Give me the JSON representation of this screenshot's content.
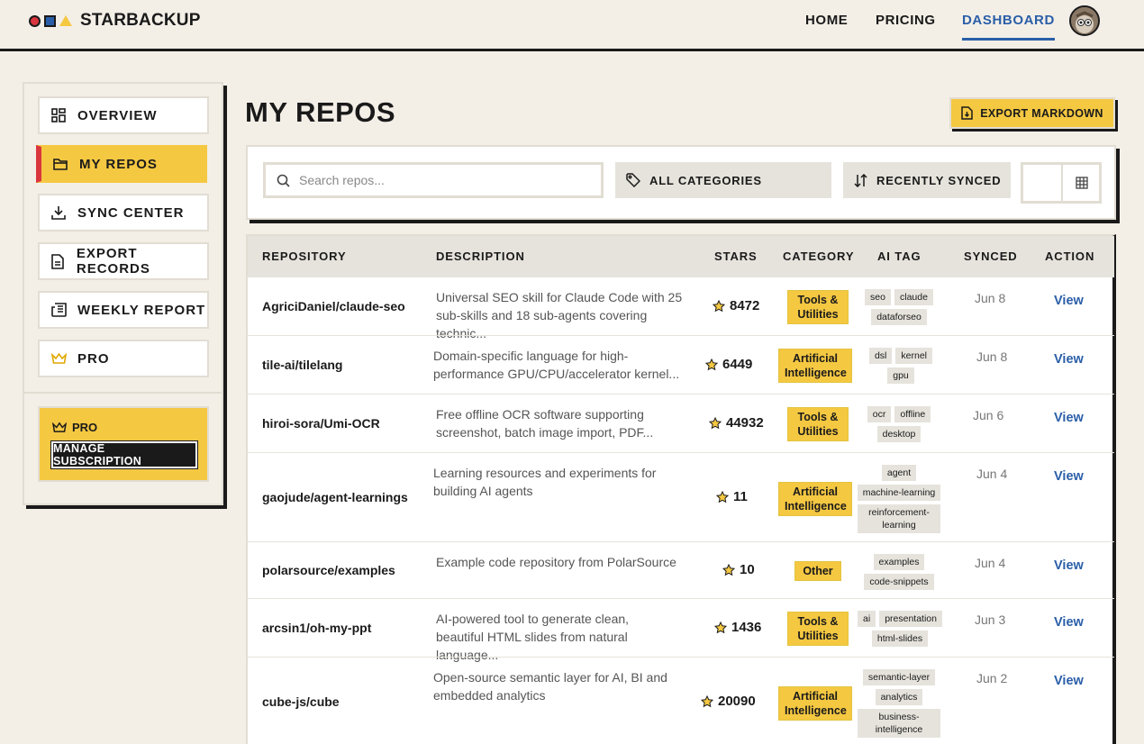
{
  "app": {
    "name": "STARBACKUP"
  },
  "nav": {
    "home": "HOME",
    "pricing": "PRICING",
    "dashboard": "DASHBOARD"
  },
  "sidebar": {
    "items": [
      {
        "label": "OVERVIEW",
        "icon": "grid-icon"
      },
      {
        "label": "MY REPOS",
        "icon": "folder-icon"
      },
      {
        "label": "SYNC CENTER",
        "icon": "download-icon"
      },
      {
        "label": "EXPORT RECORDS",
        "icon": "document-icon"
      },
      {
        "label": "WEEKLY REPORT",
        "icon": "newspaper-icon"
      },
      {
        "label": "PRO",
        "icon": "crown-icon"
      }
    ],
    "pro_card": {
      "label": "PRO",
      "button": "MANAGE SUBSCRIPTION"
    }
  },
  "main": {
    "title": "MY REPOS",
    "export_button": "EXPORT MARKDOWN",
    "search_placeholder": "Search repos...",
    "category_filter": "ALL CATEGORIES",
    "sort": "RECENTLY SYNCED"
  },
  "table": {
    "headers": [
      "REPOSITORY",
      "DESCRIPTION",
      "STARS",
      "CATEGORY",
      "AI TAG",
      "SYNCED",
      "ACTION"
    ],
    "rows": [
      {
        "repo": "AgriciDaniel/claude-seo",
        "desc": "Universal SEO skill for Claude Code with 25 sub-skills and 18 sub-agents covering technic...",
        "stars": "8472",
        "category": "Tools & Utilities",
        "tags": [
          "seo",
          "claude",
          "dataforseo"
        ],
        "synced": "Jun 8",
        "action": "View"
      },
      {
        "repo": "tile-ai/tilelang",
        "desc": "Domain-specific language for high-performance GPU/CPU/accelerator kernel...",
        "stars": "6449",
        "category": "Artificial Intelligence",
        "tags": [
          "dsl",
          "kernel",
          "gpu"
        ],
        "synced": "Jun 8",
        "action": "View"
      },
      {
        "repo": "hiroi-sora/Umi-OCR",
        "desc": "Free offline OCR software supporting screenshot, batch image import, PDF...",
        "stars": "44932",
        "category": "Tools & Utilities",
        "tags": [
          "ocr",
          "offline",
          "desktop"
        ],
        "synced": "Jun 6",
        "action": "View"
      },
      {
        "repo": "gaojude/agent-learnings",
        "desc": "Learning resources and experiments for building AI agents",
        "stars": "11",
        "category": "Artificial Intelligence",
        "tags": [
          "agent",
          "machine-learning",
          "reinforcement-learning"
        ],
        "synced": "Jun 4",
        "action": "View"
      },
      {
        "repo": "polarsource/examples",
        "desc": "Example code repository from PolarSource",
        "stars": "10",
        "category": "Other",
        "tags": [
          "examples",
          "code-snippets"
        ],
        "synced": "Jun 4",
        "action": "View"
      },
      {
        "repo": "arcsin1/oh-my-ppt",
        "desc": "AI-powered tool to generate clean, beautiful HTML slides from natural language...",
        "stars": "1436",
        "category": "Tools & Utilities",
        "tags": [
          "ai",
          "presentation",
          "html-slides"
        ],
        "synced": "Jun 3",
        "action": "View"
      },
      {
        "repo": "cube-js/cube",
        "desc": "Open-source semantic layer for AI, BI and embedded analytics",
        "stars": "20090",
        "category": "Artificial Intelligence",
        "tags": [
          "semantic-layer",
          "analytics",
          "business-intelligence"
        ],
        "synced": "Jun 2",
        "action": "View"
      }
    ]
  },
  "colors": {
    "accent": "#f5c842",
    "brand_blue": "#2a5ea8",
    "brand_red": "#d9363e",
    "background": "#f3efe7"
  }
}
